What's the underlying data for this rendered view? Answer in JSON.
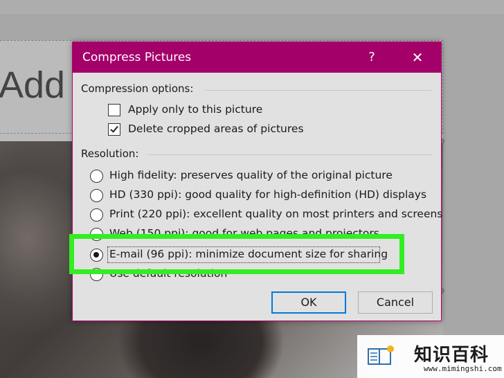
{
  "background": {
    "slide_title": "Add title"
  },
  "dialog": {
    "title": "Compress Pictures",
    "help_glyph": "?",
    "close_glyph": "✕",
    "accent_color": "#a3006a",
    "compression": {
      "label": "Compression options:",
      "options": [
        {
          "label": "Apply only to this picture",
          "checked": false
        },
        {
          "label": "Delete cropped areas of pictures",
          "checked": true
        }
      ]
    },
    "resolution": {
      "label": "Resolution:",
      "options": [
        {
          "label": "High fidelity: preserves quality of the original picture",
          "selected": false
        },
        {
          "label": "HD (330 ppi): good quality for high-definition (HD) displays",
          "selected": false
        },
        {
          "label": "Print (220 ppi): excellent quality on most printers and screens",
          "selected": false
        },
        {
          "label": "Web (150 ppi): good for web pages and projectors",
          "selected": false
        },
        {
          "label": "E-mail (96 ppi): minimize document size for sharing",
          "selected": true
        },
        {
          "label": "Use default resolution",
          "selected": false
        }
      ]
    },
    "buttons": {
      "ok": "OK",
      "cancel": "Cancel"
    }
  },
  "overlay": {
    "highlight_color": "#33ee22"
  },
  "watermark": {
    "text": "知识百科",
    "url": "www.mimingshi.com"
  }
}
